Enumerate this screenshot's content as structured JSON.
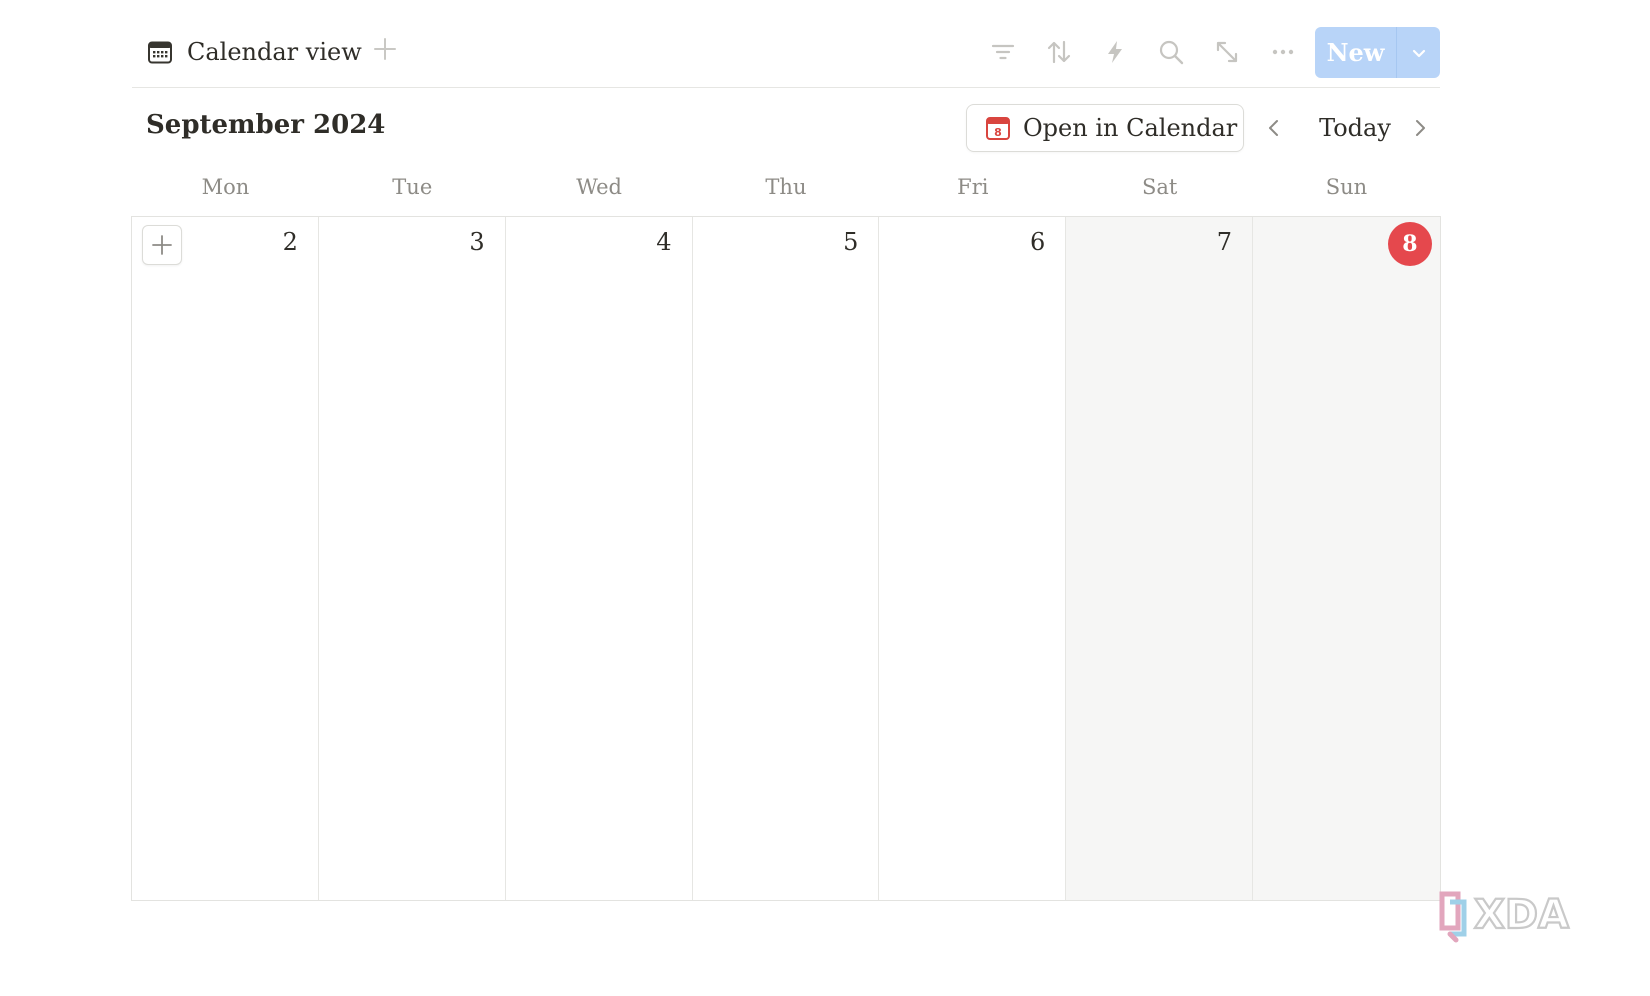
{
  "toolbar": {
    "view_label": "Calendar view",
    "view_icon": "calendar-icon",
    "add_view_icon": "plus-icon",
    "tools": [
      {
        "name": "filter-icon"
      },
      {
        "name": "sort-icon"
      },
      {
        "name": "automation-bolt-icon"
      },
      {
        "name": "search-icon"
      },
      {
        "name": "expand-icon"
      },
      {
        "name": "more-options-icon"
      }
    ],
    "new_label": "New",
    "new_color": "#b8d4f8"
  },
  "calendar": {
    "month_title": "September 2024",
    "open_label": "Open in Calendar",
    "open_icon_day": "8",
    "today_label": "Today",
    "weekdays": [
      "Mon",
      "Tue",
      "Wed",
      "Thu",
      "Fri",
      "Sat",
      "Sun"
    ],
    "days": [
      {
        "num": "2",
        "weekend": false,
        "today": false
      },
      {
        "num": "3",
        "weekend": false,
        "today": false
      },
      {
        "num": "4",
        "weekend": false,
        "today": false
      },
      {
        "num": "5",
        "weekend": false,
        "today": false
      },
      {
        "num": "6",
        "weekend": false,
        "today": false
      },
      {
        "num": "7",
        "weekend": true,
        "today": false
      },
      {
        "num": "8",
        "weekend": true,
        "today": true
      }
    ],
    "today_color": "#e5484d",
    "weekend_bg": "#f6f6f5"
  },
  "watermark": {
    "text": "XDA"
  }
}
